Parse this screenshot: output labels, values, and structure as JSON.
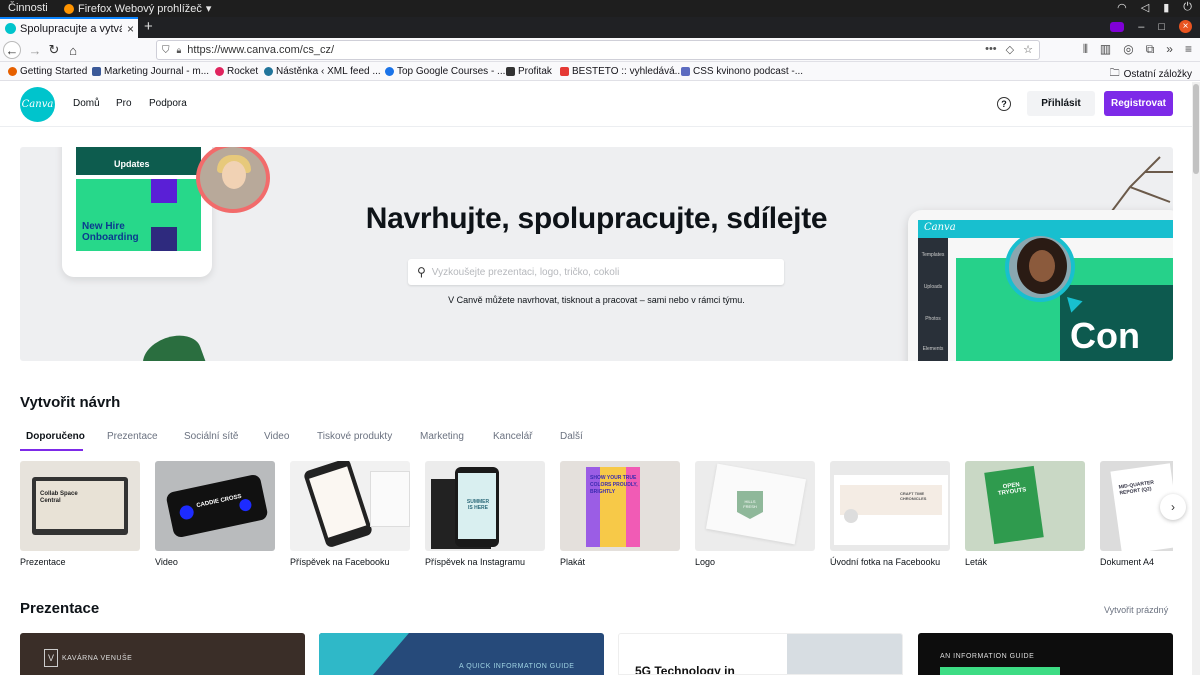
{
  "os": {
    "activities": "Činnosti",
    "app_menu": "Firefox Webový prohlížeč"
  },
  "browser": {
    "tab_title": "Spolupracujte a vytvářej",
    "url": "https://www.canva.com/cs_cz/",
    "bookmarks": [
      {
        "label": "Getting Started",
        "color": "#e66000"
      },
      {
        "label": "Marketing Journal - m...",
        "color": "#3b5998"
      },
      {
        "label": "Rocket",
        "color": "#e0245e"
      },
      {
        "label": "Nástěnka ‹ XML feed ...",
        "color": "#21759b"
      },
      {
        "label": "Top Google Courses - ...",
        "color": "#1a73e8"
      },
      {
        "label": "Profitak",
        "color": "#333333"
      },
      {
        "label": "BESTETO :: vyhledává...",
        "color": "#e53935"
      },
      {
        "label": "CSS kvinono podcast -...",
        "color": "#5c6bc0"
      }
    ],
    "other_bookmarks": "Ostatní záložky"
  },
  "header": {
    "logo_text": "Canva",
    "nav": [
      "Domů",
      "Pro",
      "Podpora"
    ],
    "login": "Přihlásit",
    "register": "Registrovat",
    "help_symbol": "?",
    "accent_color": "#7d2ae8",
    "brand_color": "#00c4cc"
  },
  "hero": {
    "title": "Navrhujte, spolupracujte, sdílejte",
    "search_placeholder": "Vyzkoušejte prezentaci, logo, tričko, cokoli",
    "subtitle": "V Canvě můžete navrhovat, tisknout a pracovat – sami nebo v rámci týmu.",
    "left_card_text": "New Hire Onboarding",
    "left_top_text": "Updates",
    "right_logo": "Canva",
    "right_big_text": "Con",
    "right_sidebar": [
      "Templates",
      "Uploads",
      "Photos",
      "Elements"
    ]
  },
  "create": {
    "title": "Vytvořit návrh",
    "tabs": [
      "Doporučeno",
      "Prezentace",
      "Sociální sítě",
      "Video",
      "Tiskové produkty",
      "Marketing",
      "Kancelář",
      "Další"
    ],
    "items": [
      {
        "label": "Prezentace",
        "thumb_text": "Collab Space Central"
      },
      {
        "label": "Video",
        "thumb_text": "CADDIE CROSS"
      },
      {
        "label": "Příspěvek na Facebooku",
        "thumb_text": ""
      },
      {
        "label": "Příspěvek na Instagramu",
        "thumb_text": "SUMMER IS HERE"
      },
      {
        "label": "Plakát",
        "thumb_text": "SHOW YOUR TRUE COLORS PROUDLY, BRIGHTLY"
      },
      {
        "label": "Logo",
        "thumb_text": "HILLS FRESH"
      },
      {
        "label": "Úvodní fotka na Facebooku",
        "thumb_text": "CRAFT TIME CHRONICLES"
      },
      {
        "label": "Leták",
        "thumb_text": "OPEN TRYOUTS"
      },
      {
        "label": "Dokument A4",
        "thumb_text": "MID-QUARTER REPORT (Q2)"
      }
    ]
  },
  "presentations": {
    "title": "Prezentace",
    "create_blank": "Vytvořit prázdný",
    "cards": [
      {
        "text": "KAVÁRNA VENUŠE",
        "bg": "#3a2e28"
      },
      {
        "text": "A QUICK INFORMATION GUIDE",
        "bg": "#264a7a"
      },
      {
        "text": "5G Technology in",
        "bg": "#ffffff"
      },
      {
        "text": "AN INFORMATION GUIDE",
        "bg": "#0d0d0d"
      }
    ]
  }
}
